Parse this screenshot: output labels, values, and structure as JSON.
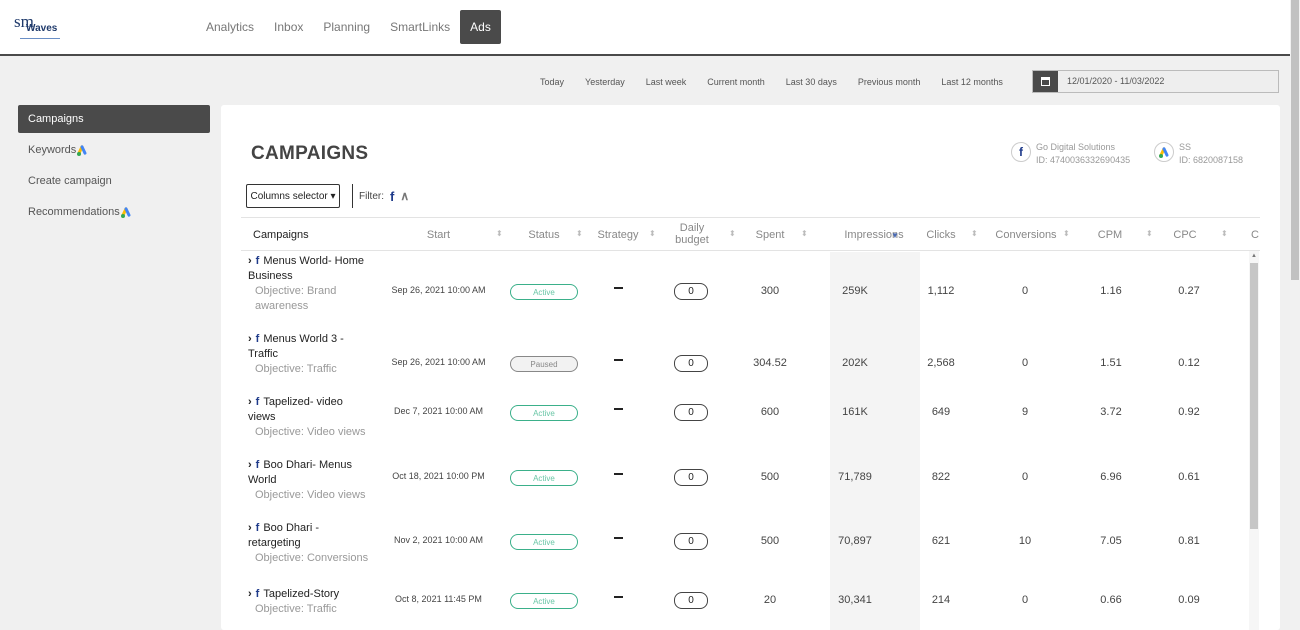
{
  "logo": {
    "sm": "sm",
    "waves": "Waves"
  },
  "nav": [
    "Analytics",
    "Inbox",
    "Planning",
    "SmartLinks",
    "Ads"
  ],
  "active_nav": "Ads",
  "date_ranges": [
    "Today",
    "Yesterday",
    "Last week",
    "Current month",
    "Last 30 days",
    "Previous month",
    "Last 12 months"
  ],
  "date_value": "12/01/2020 - 11/03/2022",
  "sidebar": [
    {
      "label": "Campaigns",
      "active": true,
      "gads": false
    },
    {
      "label": "Keywords",
      "active": false,
      "gads": true
    },
    {
      "label": "Create campaign",
      "active": false,
      "gads": false
    },
    {
      "label": "Recommendations",
      "active": false,
      "gads": true
    }
  ],
  "page_title": "CAMPAIGNS",
  "accounts": [
    {
      "type": "facebook-icon",
      "name": "Go Digital Solutions",
      "id": "ID: 4740036332690435"
    },
    {
      "type": "google-ads-icon",
      "name": "SS",
      "id": "ID: 6820087158"
    }
  ],
  "controls": {
    "columns_selector": "Columns selector ▾",
    "filter_label": "Filter:"
  },
  "columns": [
    "Campaigns",
    "Start",
    "Status",
    "Strategy",
    "Daily budget",
    "Spent",
    "Impressions",
    "Clicks",
    "Conversions",
    "CPM",
    "CPC",
    "C"
  ],
  "rows": [
    {
      "name": "Menus World- Home Business",
      "objective": "Objective: Brand awareness",
      "start": "Sep 26, 2021 10:00 AM",
      "status": "Active",
      "budget": "0",
      "spent": "300",
      "impressions": "259K",
      "clicks": "1,112",
      "conversions": "0",
      "cpm": "1.16",
      "cpc": "0.27"
    },
    {
      "name": "Menus World 3 - Traffic",
      "objective": "Objective: Traffic",
      "start": "Sep 26, 2021 10:00 AM",
      "status": "Paused",
      "budget": "0",
      "spent": "304.52",
      "impressions": "202K",
      "clicks": "2,568",
      "conversions": "0",
      "cpm": "1.51",
      "cpc": "0.12"
    },
    {
      "name": "Tapelized- video views",
      "objective": "Objective: Video views",
      "start": "Dec 7, 2021 10:00 AM",
      "status": "Active",
      "budget": "0",
      "spent": "600",
      "impressions": "161K",
      "clicks": "649",
      "conversions": "9",
      "cpm": "3.72",
      "cpc": "0.92"
    },
    {
      "name": "Boo Dhari- Menus World",
      "objective": "Objective: Video views",
      "start": "Oct 18, 2021 10:00 PM",
      "status": "Active",
      "budget": "0",
      "spent": "500",
      "impressions": "71,789",
      "clicks": "822",
      "conversions": "0",
      "cpm": "6.96",
      "cpc": "0.61"
    },
    {
      "name": "Boo Dhari - retargeting",
      "objective": "Objective: Conversions",
      "start": "Nov 2, 2021 10:00 AM",
      "status": "Active",
      "budget": "0",
      "spent": "500",
      "impressions": "70,897",
      "clicks": "621",
      "conversions": "10",
      "cpm": "7.05",
      "cpc": "0.81"
    },
    {
      "name": "Tapelized-Story",
      "objective": "Objective: Traffic",
      "start": "Oct 8, 2021 11:45 PM",
      "status": "Active",
      "budget": "0",
      "spent": "20",
      "impressions": "30,341",
      "clicks": "214",
      "conversions": "0",
      "cpm": "0.66",
      "cpc": "0.09"
    }
  ]
}
